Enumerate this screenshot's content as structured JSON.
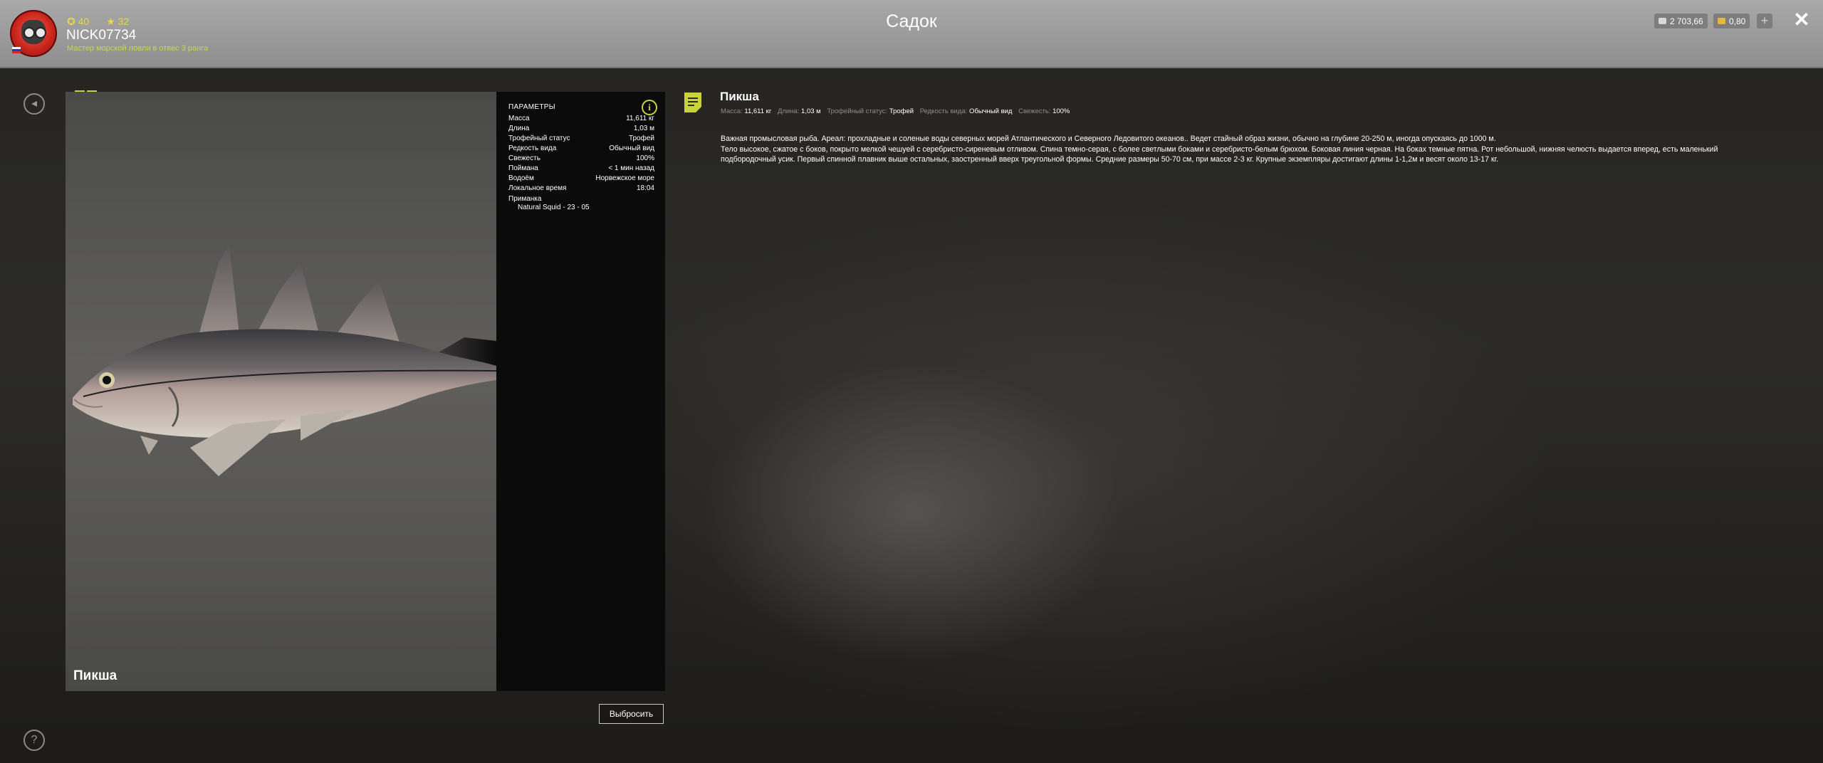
{
  "header": {
    "title": "Садок",
    "player": {
      "level": "40",
      "stars": "32",
      "name": "NICK07734",
      "rank": "Мастер морской ловли в отвес 3 ранга"
    },
    "currency": [
      {
        "icon": "silver-coins-icon",
        "value": "2 703,66"
      },
      {
        "icon": "gold-coins-icon",
        "value": "0,80"
      }
    ],
    "add_label": "+",
    "close_label": "✕"
  },
  "fish": {
    "name": "Пикша",
    "photo_label": "Пикша",
    "params_header": "ПАРАМЕТРЫ",
    "params": [
      {
        "label": "Масса",
        "value": "11,611 кг"
      },
      {
        "label": "Длина",
        "value": "1,03 м"
      },
      {
        "label": "Трофейный статус",
        "value": "Трофей"
      },
      {
        "label": "Редкость вида",
        "value": "Обычный вид"
      },
      {
        "label": "Свежесть",
        "value": "100%"
      },
      {
        "label": "Поймана",
        "value": "< 1 мин назад"
      },
      {
        "label": "Водоём",
        "value": "Норвежское море"
      },
      {
        "label": "Локальное время",
        "value": "18:04"
      }
    ],
    "bait_label": "Приманка",
    "bait_value": "Natural Squid - 23 - 05",
    "discard_label": "Выбросить"
  },
  "description": {
    "title": "Пикша",
    "meta": [
      {
        "label": "Масса:",
        "value": "11,611 кг"
      },
      {
        "label": "Длина:",
        "value": "1,03 м"
      },
      {
        "label": "Трофейный статус:",
        "value": "Трофей"
      },
      {
        "label": "Редкость вида:",
        "value": "Обычный вид"
      },
      {
        "label": "Свежесть:",
        "value": "100%"
      }
    ],
    "paragraphs": [
      "Важная промысловая рыба. Ареал: прохладные и соленые воды северных морей Атлантического и Северного Ледовитого океанов.. Ведет стайный образ жизни, обычно на глубине 20-250 м, иногда опускаясь до 1000 м.",
      "Тело высокое, сжатое с боков, покрыто мелкой чешуей с серебристо-сиреневым отливом. Спина темно-серая, с более светлыми боками и серебристо-белым брюхом. Боковая линия черная. На боках темные пятна. Рот небольшой, нижняя челюсть выдается вперед, есть маленький подбородочный усик. Первый спинной плавник выше остальных, заостренный вверх треугольной формы. Средние размеры 50-70 см, при массе 2-3 кг. Крупные экземпляры достигают длины 1-1,2м и весят около 13-17 кг."
    ]
  },
  "colors": {
    "accent": "#c9d23a",
    "header_bg": "#9b9b9b",
    "panel_bg": "#0b0b0b"
  }
}
